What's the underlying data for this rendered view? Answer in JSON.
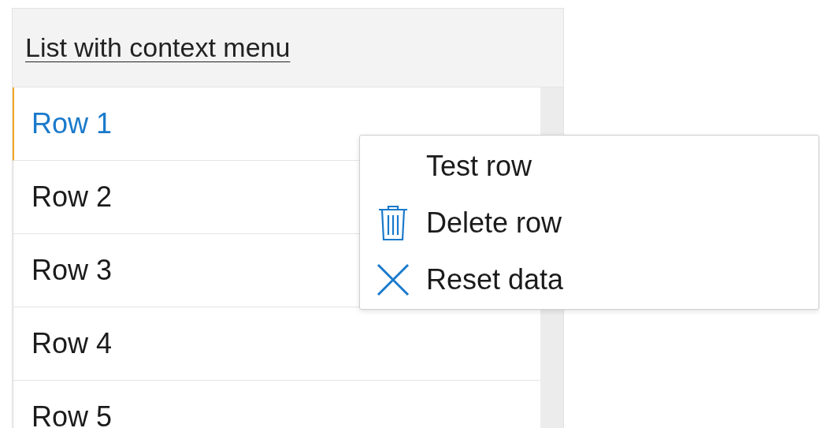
{
  "list": {
    "title": "List with context menu",
    "rows": [
      {
        "label": "Row 1",
        "selected": true
      },
      {
        "label": "Row 2",
        "selected": false
      },
      {
        "label": "Row 3",
        "selected": false
      },
      {
        "label": "Row 4",
        "selected": false
      },
      {
        "label": "Row 5",
        "selected": false
      }
    ]
  },
  "context_menu": {
    "items": [
      {
        "label": "Test row",
        "kind": "plain"
      },
      {
        "label": "Delete row",
        "kind": "delete"
      },
      {
        "label": "Reset data",
        "kind": "reset"
      }
    ]
  }
}
